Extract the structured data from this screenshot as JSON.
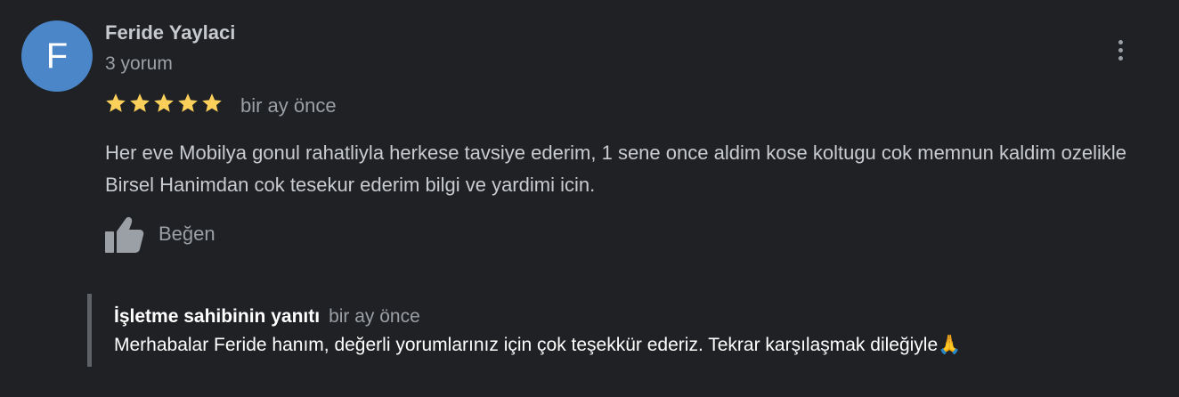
{
  "review": {
    "author": {
      "initial": "F",
      "name": "Feride Yaylaci",
      "review_count": "3 yorum",
      "avatar_color": "#4a86c8"
    },
    "rating": 5,
    "star_color": "#fbd05a",
    "date": "bir ay önce",
    "text": "Her eve Mobilya gonul rahatliyla herkese tavsiye ederim, 1 sene once aldim kose koltugu cok memnun kaldim ozelikle Birsel Hanimdan cok tesekur ederim bilgi ve yardimi icin.",
    "like_label": "Beğen",
    "more_icon": "more-vert-icon",
    "like_icon": "thumbs-up-icon"
  },
  "owner_reply": {
    "title": "İşletme sahibinin yanıtı",
    "date": "bir ay önce",
    "text": "Merhabalar Feride hanım, değerli yorumlarınız için çok teşekkür ederiz. Tekrar karşılaşmak dileğiyle🙏"
  }
}
